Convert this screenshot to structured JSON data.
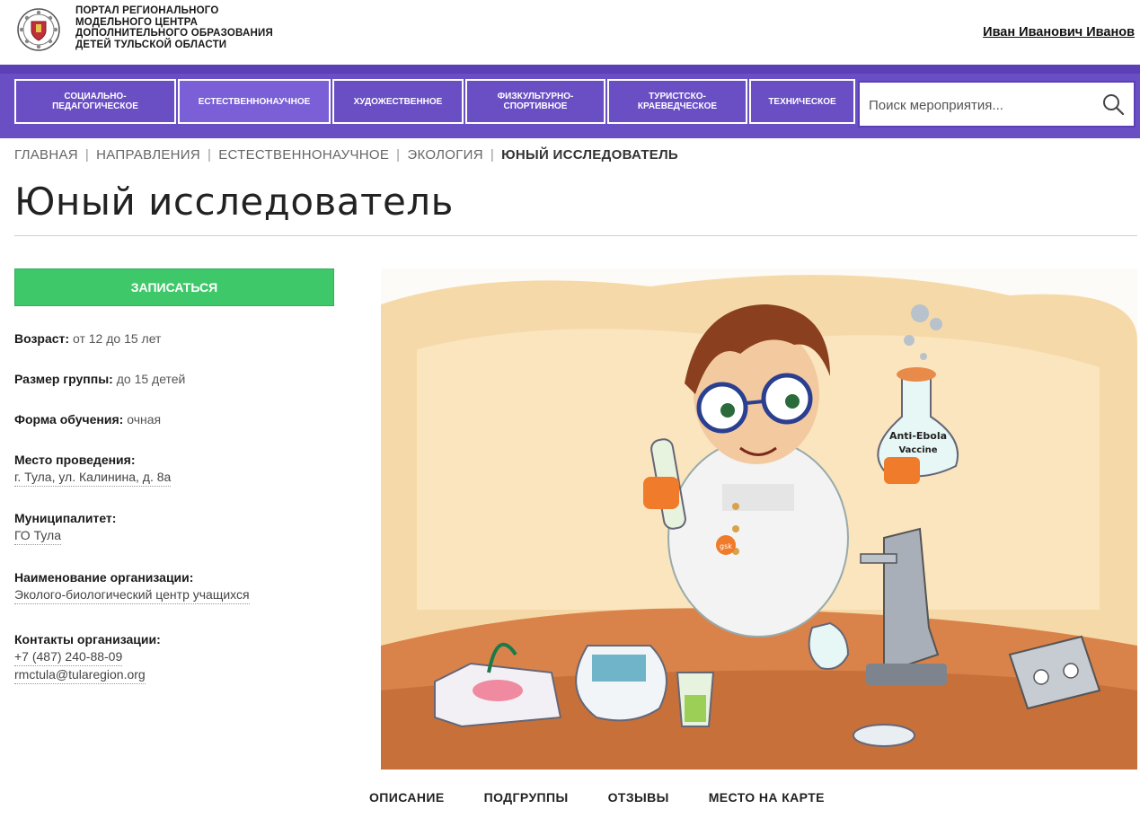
{
  "header": {
    "portal_title_lines": [
      "ПОРТАЛ РЕГИОНАЛЬНОГО",
      "МОДЕЛЬНОГО ЦЕНТРА",
      "ДОПОЛНИТЕЛЬНОГО ОБРАЗОВАНИЯ",
      "ДЕТЕЙ ТУЛЬСКОЙ ОБЛАСТИ"
    ],
    "user_name": "Иван Иванович Иванов"
  },
  "nav": {
    "items": [
      {
        "label": "СОЦИАЛЬНО-\nПЕДАГОГИЧЕСКОЕ"
      },
      {
        "label": "ЕСТЕСТВЕННОНАУЧНОЕ"
      },
      {
        "label": "ХУДОЖЕСТВЕННОЕ"
      },
      {
        "label": "ФИЗКУЛЬТУРНО-\nСПОРТИВНОЕ"
      },
      {
        "label": "ТУРИСТСКО-\nКРАЕВЕДЧЕСКОЕ"
      },
      {
        "label": "ТЕХНИЧЕСКОЕ"
      }
    ],
    "search_placeholder": "Поиск мероприятия..."
  },
  "breadcrumb": [
    "ГЛАВНАЯ",
    "НАПРАВЛЕНИЯ",
    "ЕСТЕСТВЕННОНАУЧНОЕ",
    "ЭКОЛОГИЯ",
    "ЮНЫЙ ИССЛЕДОВАТЕЛЬ"
  ],
  "page_title": "Юный исследователь",
  "enroll_button": "ЗАПИСАТЬСЯ",
  "info": {
    "age_label": "Возраст:",
    "age_value": "от 12 до 15 лет",
    "group_label": "Размер группы:",
    "group_value": "до 15 детей",
    "form_label": "Форма обучения:",
    "form_value": "очная",
    "place_label": "Место проведения:",
    "place_value": "г. Тула, ул. Калинина, д. 8а",
    "municipality_label": "Муниципалитет:",
    "municipality_value": "ГО Тула",
    "org_label": "Наименование организации:",
    "org_value": "Эколого-биологический центр учащихся",
    "contacts_label": "Контакты организации:",
    "phone": "+7 (487) 240-88-09",
    "email": "rmctula@tularegion.org"
  },
  "illustration": {
    "flask_text_1": "Anti-Ebola",
    "flask_text_2": "Vaccine",
    "coat_logo": "gsk"
  },
  "tabs": [
    "ОПИСАНИЕ",
    "ПОДГРУППЫ",
    "ОТЗЫВЫ",
    "МЕСТО НА КАРТЕ"
  ]
}
